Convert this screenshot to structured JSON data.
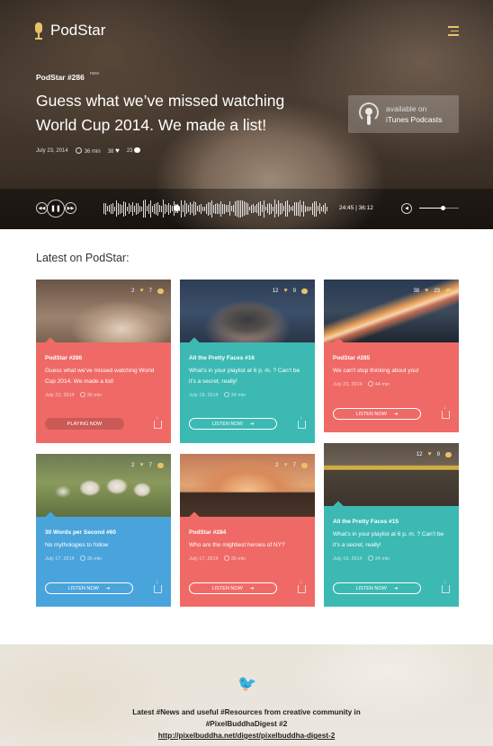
{
  "app": {
    "name": "PodStar"
  },
  "featured": {
    "episode": "PodStar #286",
    "badge": "new",
    "title": "Guess what we’ve missed watching World Cup 2014. We made a list!",
    "date": "July 23, 2014",
    "duration": "36 min",
    "likes": "38",
    "comments": "23",
    "itunes_line1": "available on",
    "itunes_line2": "iTunes Podcasts"
  },
  "player": {
    "time": "24:45 | 36:12",
    "progress": 0.68,
    "volume": 0.6
  },
  "latest": {
    "heading": "Latest on PodStar:",
    "cards": [
      {
        "likes": "2",
        "comments": "7",
        "title": "PodStar #286",
        "desc": "Guess what we’ve missed watching World Cup 2014. We made a list!",
        "date": "July 23, 2014",
        "duration": "36 min",
        "button": "PLAYING NOW"
      },
      {
        "likes": "12",
        "comments": "9",
        "title": "All the Pretty Faces #16",
        "desc": "What’s in your playlist at 6 p. m. ? Can’t be it’s a secret, really!",
        "date": "July 19, 2014",
        "duration": "34 min",
        "button": "LISTEN NOW"
      },
      {
        "likes": "38",
        "comments": "23",
        "title": "PodStar #285",
        "desc": "We can’t stop thinking about you!",
        "date": "July 23, 2014",
        "duration": "44 min",
        "button": "LISTEN NOW"
      },
      {
        "likes": "2",
        "comments": "7",
        "title": "30 Words per Second #60",
        "desc": "No mythologies to follow",
        "date": "July 17, 2014",
        "duration": "36 min",
        "button": "LISTEN NOW"
      },
      {
        "likes": "2",
        "comments": "7",
        "title": "PodStar #284",
        "desc": "Who are the mightiest heroes of NY?",
        "date": "July 17, 2014",
        "duration": "36 min",
        "button": "LISTEN NOW"
      },
      {
        "likes": "12",
        "comments": "9",
        "title": "All the Pretty Faces #15",
        "desc": "What’s in your playlist at 6 p. m. ? Can’t be it’s a secret, really!",
        "date": "July 19, 2014",
        "duration": "34 min",
        "button": "LISTEN NOW"
      }
    ]
  },
  "footer": {
    "line1": "Latest #News and useful #Resources from creative community in",
    "line2": "#PixelBuddhaDigest #2",
    "link": "http://pixelbuddha.net/digest/pixelbuddha-digest-2"
  },
  "colors": {
    "coral": "#ef6a67",
    "teal": "#3cb9b3",
    "blue": "#4aa4dc",
    "accent": "#e8c26a"
  }
}
